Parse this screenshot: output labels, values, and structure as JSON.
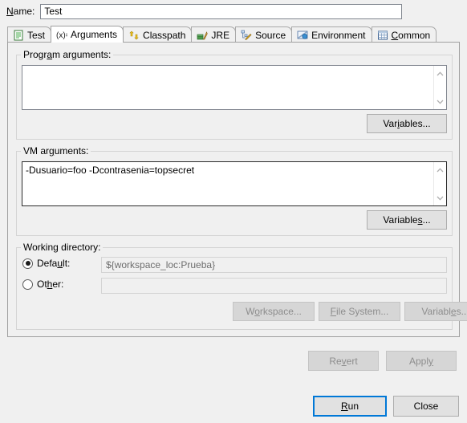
{
  "name_field": {
    "label": "Name:",
    "label_mnemonic": "N",
    "value": "Test"
  },
  "tabs": [
    {
      "label": "Test",
      "icon": "test-document-icon",
      "active": false,
      "mnemonic": ""
    },
    {
      "label": "Arguments",
      "icon": "arguments-xequals-icon",
      "active": true,
      "mnemonic": ""
    },
    {
      "label": "Classpath",
      "icon": "classpath-arrows-icon",
      "active": false,
      "mnemonic": ""
    },
    {
      "label": "JRE",
      "icon": "jre-books-icon",
      "active": false,
      "mnemonic": ""
    },
    {
      "label": "Source",
      "icon": "source-pencil-icon",
      "active": false,
      "mnemonic": ""
    },
    {
      "label": "Environment",
      "icon": "environment-monitor-icon",
      "active": false,
      "mnemonic": ""
    },
    {
      "label": "Common",
      "icon": "common-table-icon",
      "active": false,
      "mnemonic": "C"
    }
  ],
  "program_arguments": {
    "group_title": "Program arguments:",
    "group_title_mnemonic": "a",
    "value": "",
    "variables_button": "Variables...",
    "variables_mnemonic": "i"
  },
  "vm_arguments": {
    "group_title": "VM arguments:",
    "group_title_mnemonic": "g",
    "value": "-Dusuario=foo -Dcontrasenia=topsecret",
    "variables_button": "Variables...",
    "variables_mnemonic": "s",
    "focused": true
  },
  "working_directory": {
    "group_title": "Working directory:",
    "default_radio": {
      "label": "Default:",
      "mnemonic": "u",
      "checked": true,
      "value": "${workspace_loc:Prueba}"
    },
    "other_radio": {
      "label": "Other:",
      "mnemonic": "h",
      "checked": false,
      "value": ""
    },
    "workspace_button": "Workspace...",
    "workspace_mnemonic": "o",
    "filesystem_button": "File System...",
    "filesystem_mnemonic": "F",
    "variables_button": "Variables...",
    "variables_mnemonic": "e"
  },
  "footer": {
    "revert_button": "Revert",
    "revert_mnemonic": "v",
    "revert_disabled": true,
    "apply_button": "Apply",
    "apply_mnemonic": "y",
    "apply_disabled": true,
    "run_button": "Run",
    "run_mnemonic": "R",
    "run_is_default": true,
    "close_button": "Close"
  },
  "colors": {
    "dialog_background": "#f0f0f0",
    "panel_background": "#f0f0f0",
    "field_background": "#ffffff",
    "focus_accent": "#0078d7",
    "disabled_text": "#8d8d8d",
    "border": "#a0a0a0"
  }
}
